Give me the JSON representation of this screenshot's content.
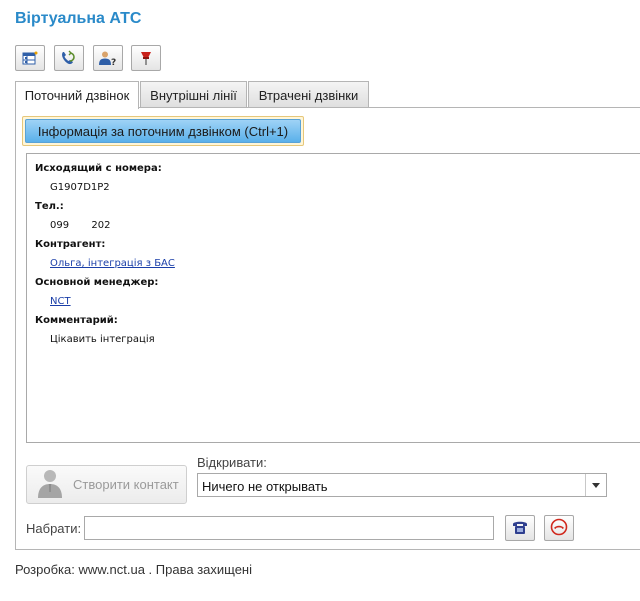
{
  "app": {
    "title": "Віртуальна АТС"
  },
  "toolbar": {
    "icons": [
      "table-icon",
      "phone-refresh-icon",
      "user-question-icon",
      "red-pin-icon"
    ]
  },
  "tabs": [
    {
      "label": "Поточний дзвінок",
      "active": true
    },
    {
      "label": "Внутрішні лінії",
      "active": false
    },
    {
      "label": "Втрачені дзвінки",
      "active": false
    }
  ],
  "info_button": {
    "label": "Інформація за поточним дзвінком (Ctrl+1)"
  },
  "details": {
    "from_label": "Исходящий с номера:",
    "from_value": "G1907D1P2",
    "phone_label": "Тел.:",
    "phone_value": "099       202",
    "counterparty_label": "Контрагент:",
    "counterparty_value": "Ольга, інтеграція з БАС",
    "manager_label": "Основной менеджер:",
    "manager_value": "NCT",
    "comment_label": "Комментарий:",
    "comment_value": "Цікавить інтеграція"
  },
  "create_contact": {
    "label": "Створити контакт"
  },
  "open": {
    "label": "Відкривати:",
    "selected": "Ничего не открывать"
  },
  "dial": {
    "label": "Набрати:",
    "value": ""
  },
  "footer": {
    "text": "Розробка: www.nct.ua . Права захищені"
  },
  "colors": {
    "title": "#2a8ac9",
    "info_button": "#5ab0ea",
    "link": "#1a3ea8"
  }
}
